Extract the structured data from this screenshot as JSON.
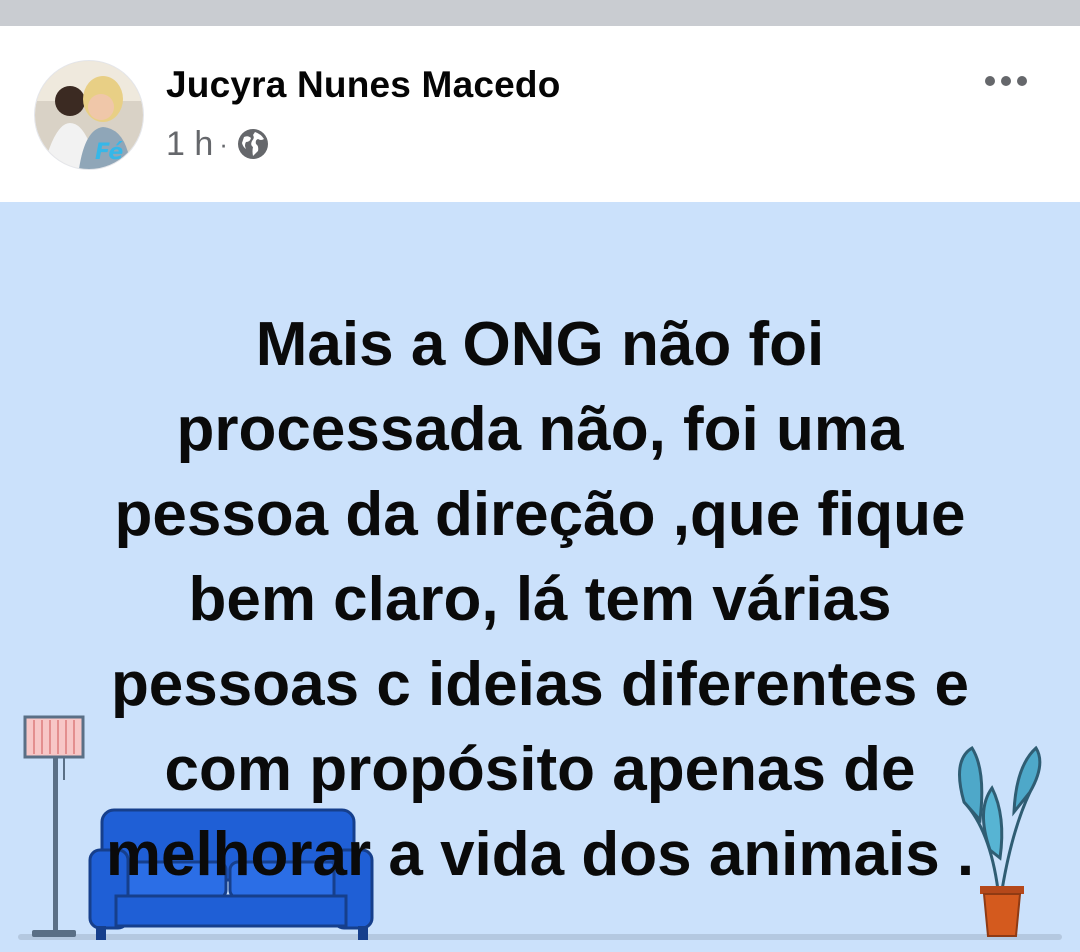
{
  "post": {
    "author": "Jucyra Nunes Macedo",
    "time": "1 h",
    "separator": "·",
    "privacy_icon": "globe-icon",
    "menu_icon": "more-horizontal-icon",
    "avatar_badge": "Fé",
    "text": "Mais a ONG não foi\nprocessada não, foi uma\npessoa da direção ,que fique\nbem claro, lá tem várias\npessoas c ideias diferentes e\ncom propósito apenas de\nmelhorar a vida dos animais ."
  },
  "colors": {
    "background_blue": "#cbe1fb",
    "sofa": "#1f5fd6",
    "plant_leaf": "#4ea8c9",
    "pot": "#d45a1e"
  }
}
